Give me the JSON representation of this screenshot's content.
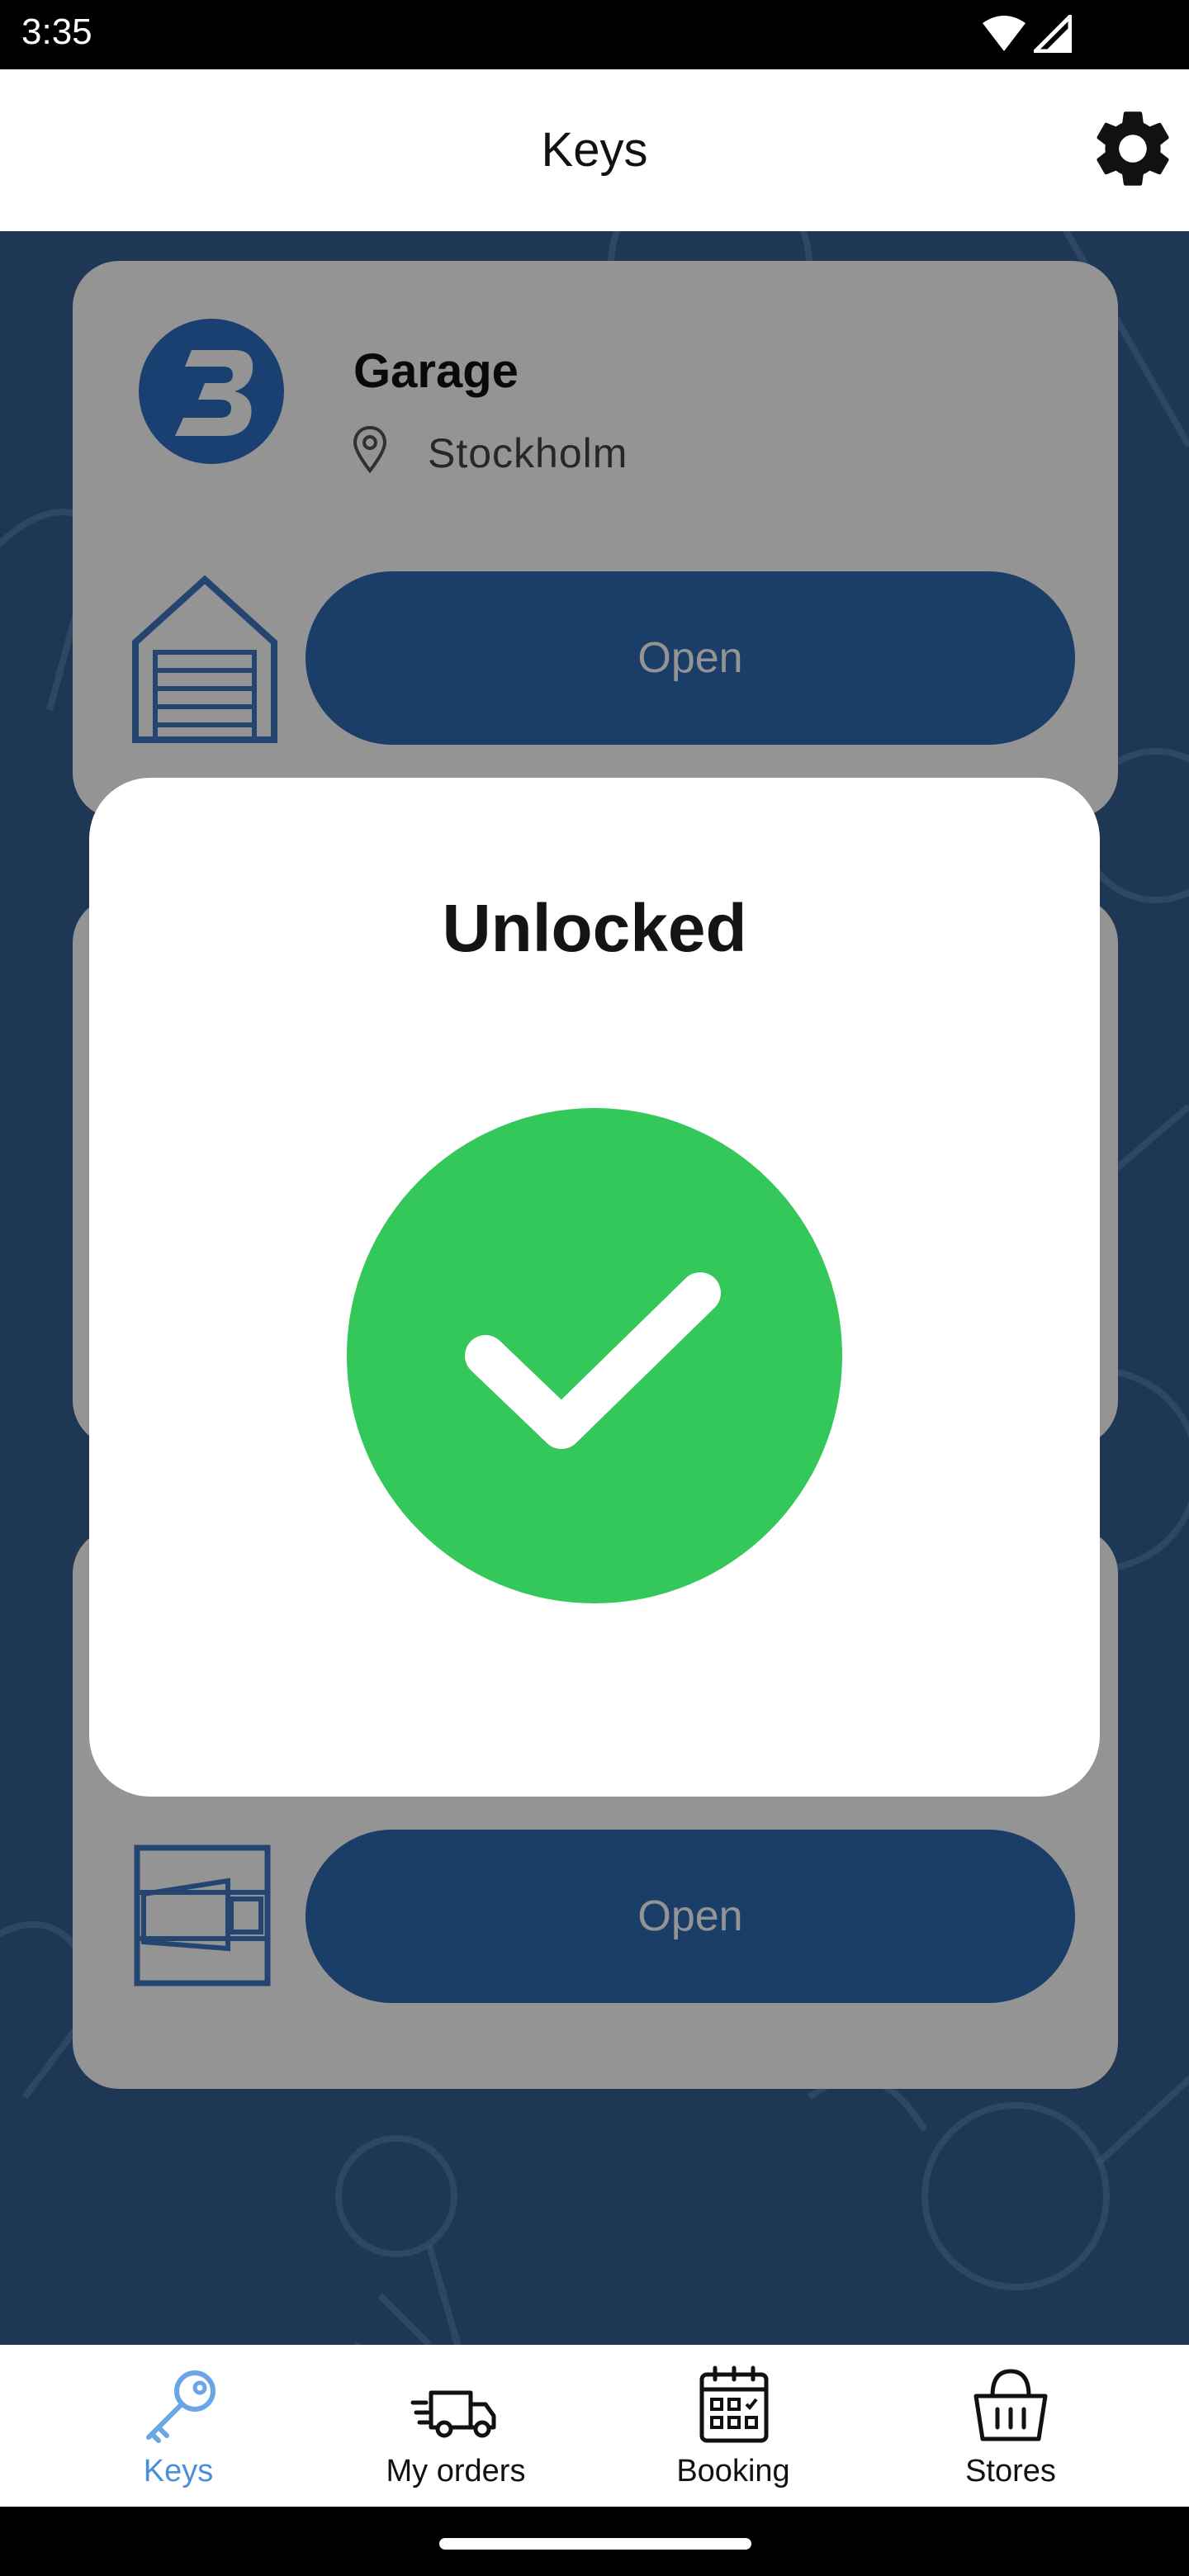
{
  "status_bar": {
    "time": "3:35",
    "wifi_icon": "wifi-icon",
    "signal_icon": "signal-icon"
  },
  "app_bar": {
    "title": "Keys",
    "settings_icon": "gear-icon"
  },
  "cards": [
    {
      "title": "Garage",
      "location": "Stockholm",
      "action_label": "Open",
      "icon": "garage-door-icon",
      "logo": "brand-logo"
    },
    {
      "action_label": "Open",
      "icon": "locker-icon"
    }
  ],
  "dialog": {
    "title": "Unlocked",
    "icon": "check-circle-icon",
    "success_color": "#34c759"
  },
  "bottom_nav": {
    "items": [
      {
        "label": "Keys",
        "icon": "key-icon",
        "active": true
      },
      {
        "label": "My orders",
        "icon": "delivery-truck-icon",
        "active": false
      },
      {
        "label": "Booking",
        "icon": "calendar-icon",
        "active": false
      },
      {
        "label": "Stores",
        "icon": "basket-icon",
        "active": false
      }
    ]
  },
  "colors": {
    "primary": "#2f6bb3",
    "background": "#325f93",
    "active_nav": "#4a90d9"
  }
}
